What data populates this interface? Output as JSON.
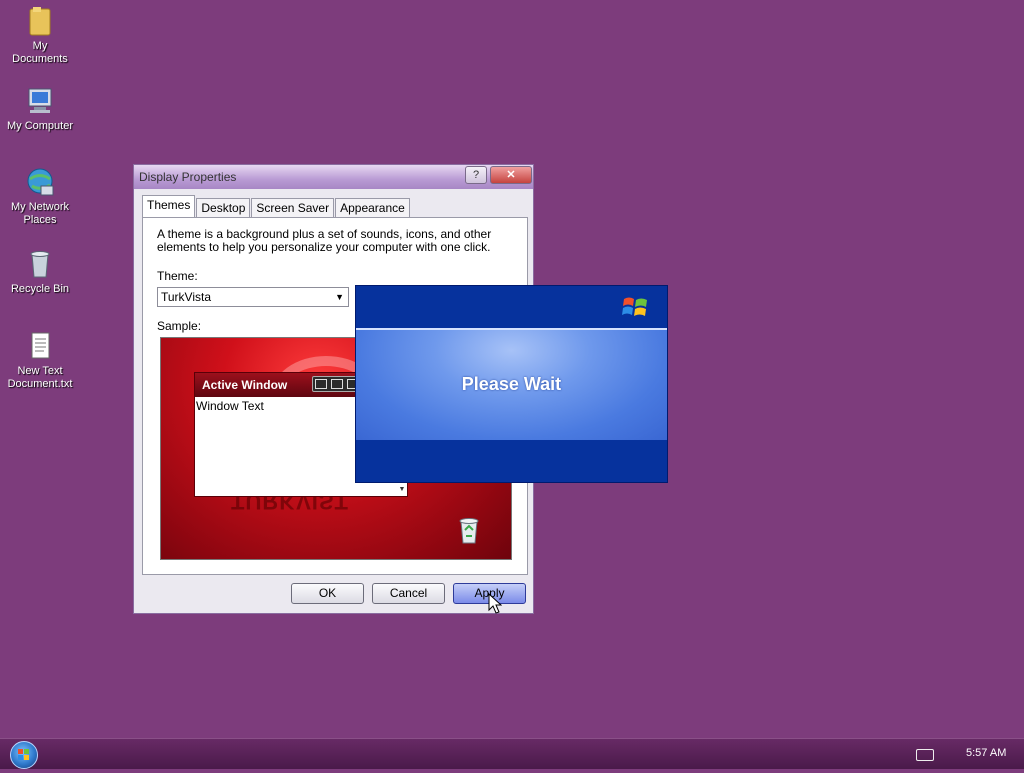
{
  "desktop": {
    "icons": [
      {
        "label": "My Documents",
        "icon": "folder-icon"
      },
      {
        "label": "My Computer",
        "icon": "computer-icon"
      },
      {
        "label": "My Network Places",
        "icon": "network-icon"
      },
      {
        "label": "Recycle Bin",
        "icon": "recycle-bin-icon"
      },
      {
        "label": "New Text Document.txt",
        "icon": "text-file-icon"
      }
    ],
    "background_color": "#7d3c7c"
  },
  "dialog": {
    "title": "Display Properties",
    "help_label": "?",
    "close_label": "✕",
    "tabs": [
      {
        "label": "Themes",
        "active": true
      },
      {
        "label": "Desktop",
        "active": false
      },
      {
        "label": "Screen Saver",
        "active": false
      },
      {
        "label": "Appearance",
        "active": false
      }
    ],
    "description": "A theme is a background plus a set of sounds, icons, and other elements to help you personalize your computer with one click.",
    "theme_label": "Theme:",
    "theme_value": "TurkVista",
    "sample_label": "Sample:",
    "sample": {
      "active_window_title": "Active Window",
      "window_text": "Window Text",
      "mirror_text": "TURKVIST"
    },
    "buttons": {
      "ok": "OK",
      "cancel": "Cancel",
      "apply": "Apply"
    }
  },
  "wait_overlay": {
    "text": "Please Wait"
  },
  "taskbar": {
    "clock": "5:57 AM",
    "accent": "#672a65"
  }
}
